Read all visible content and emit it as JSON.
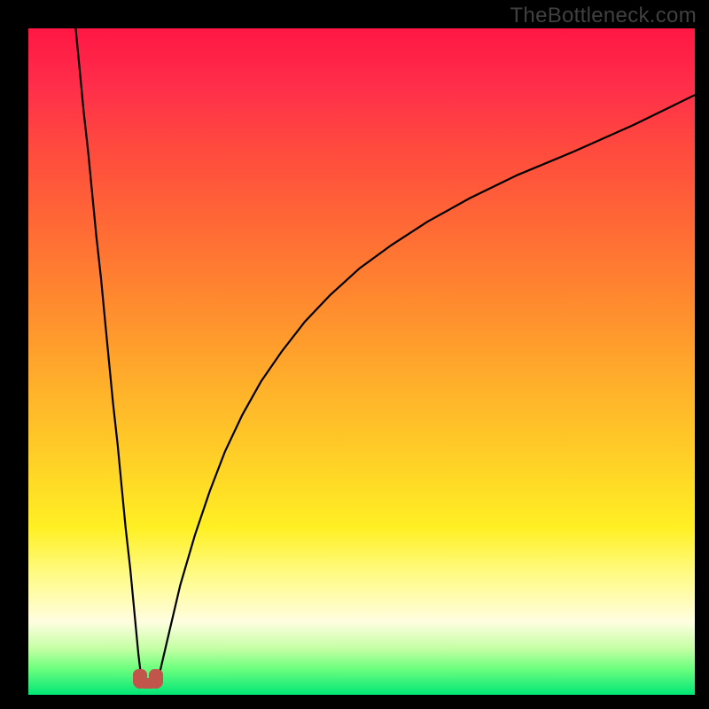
{
  "watermark": "TheBottleneck.com",
  "chart_data": {
    "type": "line",
    "title": "",
    "xlabel": "",
    "ylabel": "",
    "xlim": [
      0,
      100
    ],
    "ylim": [
      0,
      100
    ],
    "grid": false,
    "legend": false,
    "notes": "gradient background red→green top→bottom; no tick labels",
    "series": [
      {
        "name": "left-branch",
        "x": [
          7.1,
          7.7,
          8.3,
          9.0,
          9.6,
          10.2,
          10.9,
          11.5,
          12.1,
          12.7,
          13.4,
          14.0,
          14.6,
          15.3,
          15.9,
          16.5,
          17.0
        ],
        "y": [
          100,
          93.8,
          87.5,
          81.2,
          75.0,
          68.8,
          62.5,
          56.2,
          50.0,
          43.8,
          37.5,
          31.2,
          25.0,
          18.8,
          12.5,
          6.2,
          2.0
        ]
      },
      {
        "name": "right-branch",
        "x": [
          19.4,
          20.8,
          22.8,
          25.0,
          27.2,
          29.5,
          32.1,
          34.9,
          38.0,
          41.5,
          45.3,
          49.7,
          54.5,
          59.9,
          66.2,
          73.4,
          81.8,
          90.8,
          100.0
        ],
        "y": [
          2.0,
          8.0,
          16.5,
          24.0,
          30.5,
          36.5,
          42.0,
          47.0,
          51.5,
          56.0,
          60.0,
          64.0,
          67.5,
          71.0,
          74.5,
          78.0,
          81.5,
          85.5,
          90.0
        ]
      }
    ],
    "marker": {
      "x": 18.0,
      "y": 1.2,
      "shape": "u",
      "color": "#c1544b"
    }
  },
  "colors": {
    "curve": "#000000",
    "marker": "#c1544b",
    "frame": "#000000"
  }
}
